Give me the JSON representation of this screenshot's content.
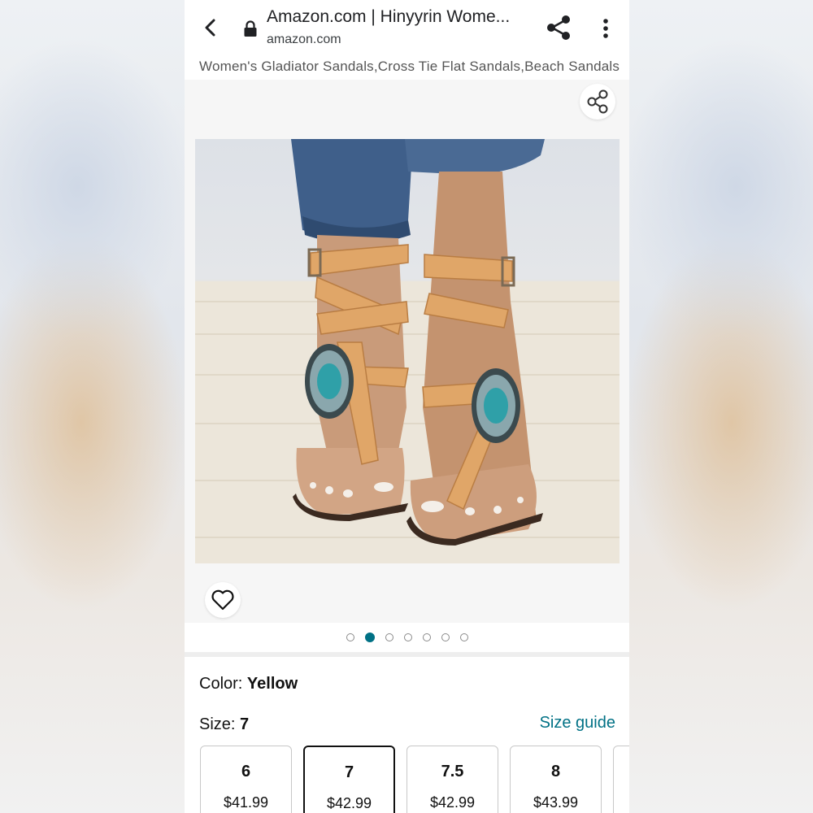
{
  "browser": {
    "tab_title": "Amazon.com | Hinyyrin Wome...",
    "domain": "amazon.com"
  },
  "product": {
    "title": "Women's Gladiator Sandals,Cross Tie Flat Sandals,Beach Sandals",
    "image_count": 7,
    "active_image_index": 1
  },
  "options": {
    "color_label": "Color: ",
    "color_value": "Yellow",
    "size_label": "Size: ",
    "size_value": "7",
    "size_guide": "Size guide",
    "sizes": [
      {
        "size": "6",
        "price": "$41.99"
      },
      {
        "size": "7",
        "price": "$42.99",
        "selected": true
      },
      {
        "size": "7.5",
        "price": "$42.99"
      },
      {
        "size": "8",
        "price": "$43.99"
      }
    ]
  },
  "icons": [
    "back-arrow-icon",
    "lock-icon",
    "share-icon",
    "more-vert-icon",
    "share-outline-icon",
    "heart-icon"
  ],
  "colors": {
    "accent": "#007185",
    "text": "#111111"
  }
}
